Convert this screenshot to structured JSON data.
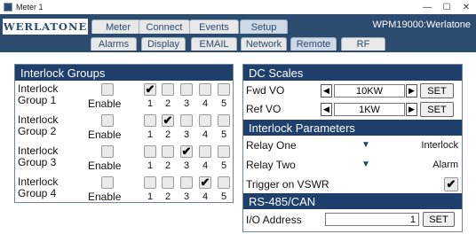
{
  "window": {
    "title": "Meter 1",
    "minimize": "—",
    "maximize": "☐",
    "close": "✕"
  },
  "brand": "WERLATONE",
  "device": "WPM19000:Werlatone",
  "main_tabs": [
    "Meter",
    "Connect",
    "Events",
    "Setup"
  ],
  "sub_tabs": [
    "Alarms",
    "Display",
    "EMAIL",
    "Network",
    "Remote",
    "RF"
  ],
  "interlock": {
    "title": "Interlock Groups",
    "enable_label": "Enable",
    "numbers": [
      "1",
      "2",
      "3",
      "4",
      "5"
    ],
    "groups": [
      {
        "line1": "Interlock",
        "line2": "Group 1",
        "enabled": false,
        "checked": [
          true,
          false,
          false,
          false,
          false
        ]
      },
      {
        "line1": "Interlock",
        "line2": "Group 2",
        "enabled": false,
        "checked": [
          false,
          true,
          false,
          false,
          false
        ]
      },
      {
        "line1": "Interlock",
        "line2": "Group 3",
        "enabled": false,
        "checked": [
          false,
          false,
          true,
          false,
          false
        ]
      },
      {
        "line1": "Interlock",
        "line2": "Group 4",
        "enabled": false,
        "checked": [
          false,
          false,
          false,
          true,
          false
        ]
      }
    ]
  },
  "dc_scales": {
    "title": "DC Scales",
    "fwd_label": "Fwd VO",
    "fwd_value": "10KW",
    "ref_label": "Ref VO",
    "ref_value": "1KW",
    "set_label": "SET",
    "left_arrow": "◀",
    "right_arrow": "▶"
  },
  "interlock_params": {
    "title": "Interlock Parameters",
    "relay_one_label": "Relay One",
    "relay_one_value": "Interlock",
    "relay_two_label": "Relay Two",
    "relay_two_value": "Alarm",
    "trigger_label": "Trigger on VSWR",
    "trigger_checked": true,
    "dd_arrow": "▼"
  },
  "rs485": {
    "title": "RS-485/CAN",
    "address_label": "I/O Address",
    "address_value": "1",
    "set_label": "SET"
  },
  "check_mark": "✔"
}
